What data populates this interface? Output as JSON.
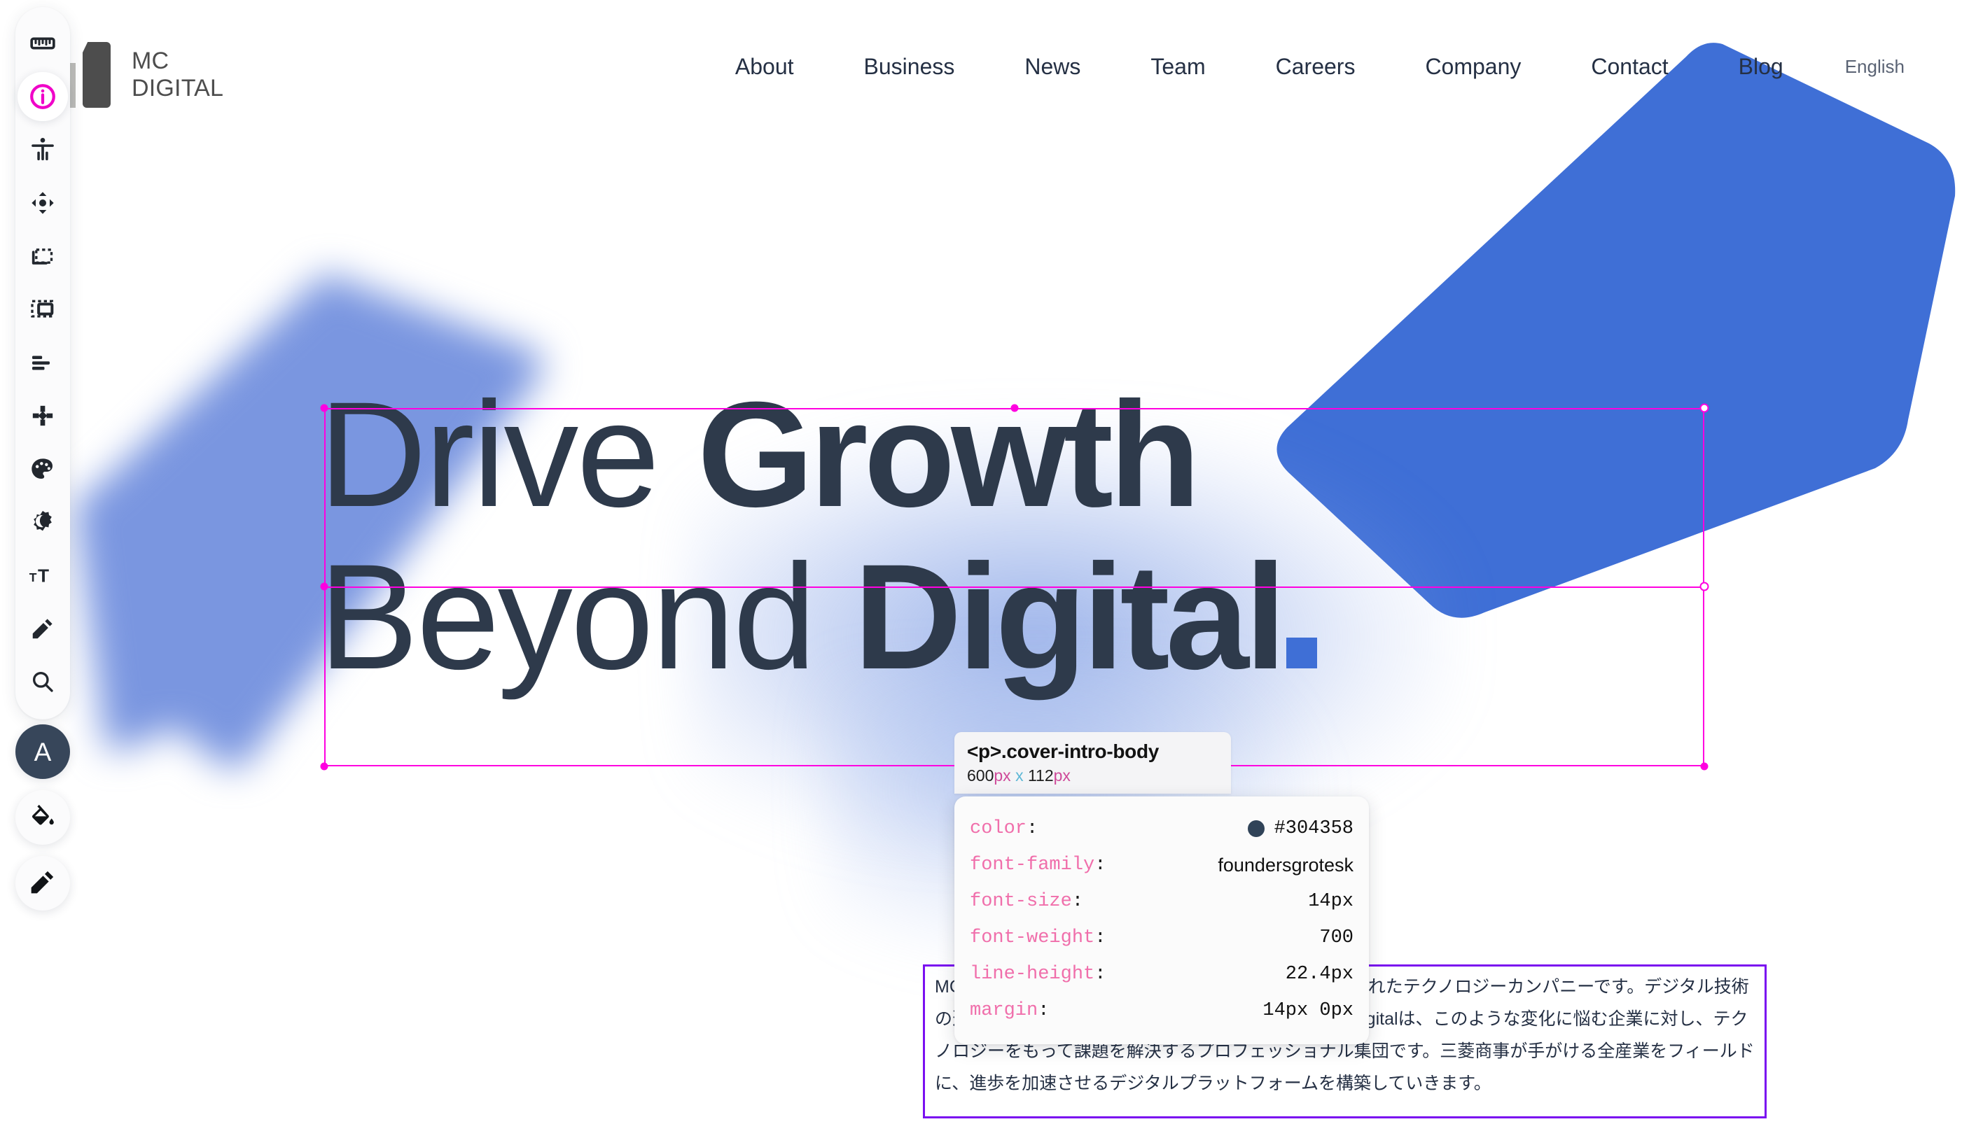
{
  "site": {
    "logo": {
      "line1": "MC",
      "line2": "DIGITAL",
      "mark_name": "mc-digital-logo-mark"
    },
    "nav": [
      {
        "label": "About"
      },
      {
        "label": "Business"
      },
      {
        "label": "News"
      },
      {
        "label": "Team"
      },
      {
        "label": "Careers"
      },
      {
        "label": "Company"
      },
      {
        "label": "Contact"
      },
      {
        "label": "Blog"
      }
    ],
    "language": "English"
  },
  "hero": {
    "line1_thin": "Drive ",
    "line1_bold": "Growth",
    "line2_thin": "Beyond ",
    "line2_bold": "Digital",
    "period": ".",
    "color": "#2E3A4B"
  },
  "paragraph": {
    "text": "MC Digitalは、三菱商事とBCGの合弁会社として設立されたテクノロジーカンパニーです。デジタル技術の進展により産業構造が大きく変化しています。MC Digitalは、このような変化に悩む企業に対し、テクノロジーをもって課題を解決するプロフェッショナル集団です。三菱商事が手がける全産業をフィールドに、進歩を加速させるデジタルプラットフォームを構築していきます。",
    "border_color": "#7A0FF0"
  },
  "inspector": {
    "selector": "<p>.cover-intro-body",
    "width": "600",
    "height": "112",
    "unit": "px",
    "times": "x",
    "properties": [
      {
        "key": "color",
        "value": "#304358",
        "swatch": "#304358"
      },
      {
        "key": "font-family",
        "value": "foundersgrotesk"
      },
      {
        "key": "font-size",
        "value": "14px"
      },
      {
        "key": "font-weight",
        "value": "700"
      },
      {
        "key": "line-height",
        "value": "22.4px"
      },
      {
        "key": "margin",
        "value": "14px 0px"
      }
    ]
  },
  "toolbar": {
    "items": [
      {
        "icon": "ruler-icon",
        "active": false
      },
      {
        "icon": "info-circle-icon",
        "active": true
      },
      {
        "icon": "accessibility-icon",
        "active": false
      },
      {
        "icon": "move-icon",
        "active": false
      },
      {
        "icon": "selection-copy-icon",
        "active": false
      },
      {
        "icon": "frame-icon",
        "active": false
      },
      {
        "icon": "align-left-icon",
        "active": false
      },
      {
        "icon": "distribute-icon",
        "active": false
      },
      {
        "icon": "palette-icon",
        "active": false
      },
      {
        "icon": "dark-mode-icon",
        "active": false
      },
      {
        "icon": "font-size-icon",
        "active": false
      },
      {
        "icon": "pencil-icon",
        "active": false
      },
      {
        "icon": "search-icon",
        "active": false
      }
    ],
    "round_tools": [
      {
        "icon": "typography-a-icon",
        "label": "A",
        "active": true
      },
      {
        "icon": "paint-bucket-icon",
        "active": false
      },
      {
        "icon": "edit-pencil-icon",
        "active": false
      }
    ],
    "accent_active": "#F000C8"
  },
  "decor": {
    "blue_solid": "#3F6FD6",
    "blue_blur": "#7A96E0",
    "selection_magenta": "#FF00E0"
  }
}
